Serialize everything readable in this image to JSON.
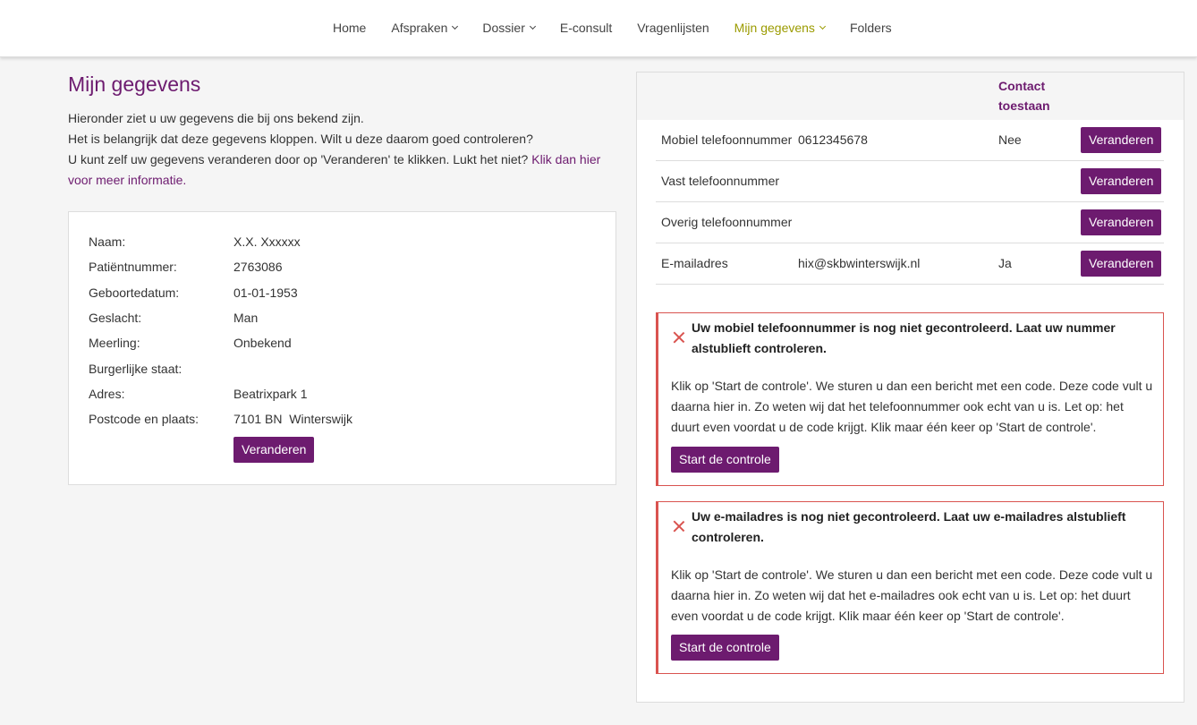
{
  "nav": {
    "items": [
      {
        "label": "Home",
        "dropdown": false,
        "active": false
      },
      {
        "label": "Afspraken",
        "dropdown": true,
        "active": false
      },
      {
        "label": "Dossier",
        "dropdown": true,
        "active": false
      },
      {
        "label": "E-consult",
        "dropdown": false,
        "active": false
      },
      {
        "label": "Vragenlijsten",
        "dropdown": false,
        "active": false
      },
      {
        "label": "Mijn gegevens",
        "dropdown": true,
        "active": true
      },
      {
        "label": "Folders",
        "dropdown": false,
        "active": false
      }
    ]
  },
  "page": {
    "title": "Mijn gegevens",
    "intro_line1": "Hieronder ziet u uw gegevens die bij ons bekend zijn.",
    "intro_line2": "Het is belangrijk dat deze gegevens kloppen. Wilt u deze daarom goed controleren?",
    "intro_line3": "U kunt zelf uw gegevens veranderen door op 'Veranderen' te klikken. Lukt het niet? ",
    "intro_link": "Klik dan hier voor meer informatie."
  },
  "personal": {
    "rows": [
      {
        "label": "Naam:",
        "value": "X.X. Xxxxxx"
      },
      {
        "label": "Patiëntnummer:",
        "value": "2763086"
      },
      {
        "label": "Geboortedatum:",
        "value": "01-01-1953"
      },
      {
        "label": "Geslacht:",
        "value": "Man"
      },
      {
        "label": "Meerling:",
        "value": "Onbekend"
      },
      {
        "label": "Burgerlijke staat:",
        "value": ""
      },
      {
        "label": "Adres:",
        "value": "Beatrixpark 1"
      },
      {
        "label": "Postcode en plaats:",
        "value": "7101 BN  Winterswijk"
      }
    ],
    "change_label": "Veranderen"
  },
  "contact": {
    "header_allowed": "Contact toestaan",
    "rows": [
      {
        "label": "Mobiel telefoonnummer",
        "value": "0612345678",
        "allowed": "Nee",
        "button": "Veranderen"
      },
      {
        "label": "Vast telefoonnummer",
        "value": "",
        "allowed": "",
        "button": "Veranderen"
      },
      {
        "label": "Overig telefoonnummer",
        "value": "",
        "allowed": "",
        "button": "Veranderen"
      },
      {
        "label": "E-mailadres",
        "value": "hix@skbwinterswijk.nl",
        "allowed": "Ja",
        "button": "Veranderen"
      }
    ]
  },
  "alerts": [
    {
      "title": "Uw mobiel telefoonnummer is nog niet gecontroleerd. Laat uw nummer alstublieft controleren.",
      "body": "Klik op 'Start de controle'. We sturen u dan een bericht met een code. Deze code vult u daarna hier in. Zo weten wij dat het telefoonnummer ook echt van u is. Let op: het duurt even voordat u de code krijgt. Klik maar één keer op 'Start de controle'.",
      "button": "Start de controle"
    },
    {
      "title": "Uw e-mailadres is nog niet gecontroleerd. Laat uw e-mailadres alstublieft controleren.",
      "body": "Klik op 'Start de controle'. We sturen u dan een bericht met een code. Deze code vult u daarna hier in. Zo weten wij dat het e-mailadres ook echt van u is. Let op: het duurt even voordat u de code krijgt. Klik maar één keer op 'Start de controle'.",
      "button": "Start de controle"
    }
  ],
  "colors": {
    "brand_purple": "#6d1b6f",
    "active_nav": "#9b9b00",
    "alert_red": "#d9534f"
  },
  "icons": {
    "nav_dropdown": "chevron-down-icon",
    "alert": "close-icon"
  }
}
